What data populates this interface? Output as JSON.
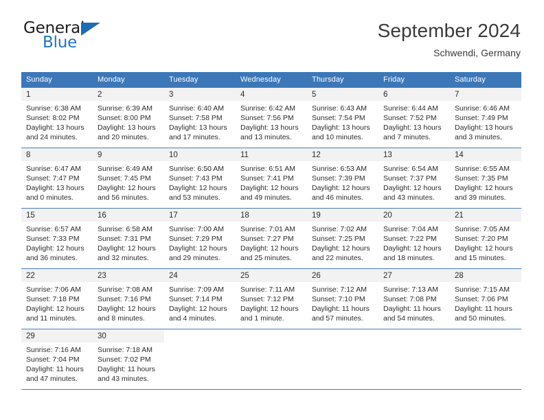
{
  "brand": {
    "name_top": "General",
    "name_bottom": "Blue",
    "triangle_color": "#1b6cb5",
    "blue_text_color": "#1f74c4"
  },
  "header": {
    "month_title": "September 2024",
    "location": "Schwendi, Germany",
    "header_bg_color": "#3c77b8"
  },
  "weekday_headers": [
    "Sunday",
    "Monday",
    "Tuesday",
    "Wednesday",
    "Thursday",
    "Friday",
    "Saturday"
  ],
  "weeks": [
    [
      {
        "day": "1",
        "sunrise": "Sunrise: 6:38 AM",
        "sunset": "Sunset: 8:02 PM",
        "daylight": "Daylight: 13 hours and 24 minutes."
      },
      {
        "day": "2",
        "sunrise": "Sunrise: 6:39 AM",
        "sunset": "Sunset: 8:00 PM",
        "daylight": "Daylight: 13 hours and 20 minutes."
      },
      {
        "day": "3",
        "sunrise": "Sunrise: 6:40 AM",
        "sunset": "Sunset: 7:58 PM",
        "daylight": "Daylight: 13 hours and 17 minutes."
      },
      {
        "day": "4",
        "sunrise": "Sunrise: 6:42 AM",
        "sunset": "Sunset: 7:56 PM",
        "daylight": "Daylight: 13 hours and 13 minutes."
      },
      {
        "day": "5",
        "sunrise": "Sunrise: 6:43 AM",
        "sunset": "Sunset: 7:54 PM",
        "daylight": "Daylight: 13 hours and 10 minutes."
      },
      {
        "day": "6",
        "sunrise": "Sunrise: 6:44 AM",
        "sunset": "Sunset: 7:52 PM",
        "daylight": "Daylight: 13 hours and 7 minutes."
      },
      {
        "day": "7",
        "sunrise": "Sunrise: 6:46 AM",
        "sunset": "Sunset: 7:49 PM",
        "daylight": "Daylight: 13 hours and 3 minutes."
      }
    ],
    [
      {
        "day": "8",
        "sunrise": "Sunrise: 6:47 AM",
        "sunset": "Sunset: 7:47 PM",
        "daylight": "Daylight: 13 hours and 0 minutes."
      },
      {
        "day": "9",
        "sunrise": "Sunrise: 6:49 AM",
        "sunset": "Sunset: 7:45 PM",
        "daylight": "Daylight: 12 hours and 56 minutes."
      },
      {
        "day": "10",
        "sunrise": "Sunrise: 6:50 AM",
        "sunset": "Sunset: 7:43 PM",
        "daylight": "Daylight: 12 hours and 53 minutes."
      },
      {
        "day": "11",
        "sunrise": "Sunrise: 6:51 AM",
        "sunset": "Sunset: 7:41 PM",
        "daylight": "Daylight: 12 hours and 49 minutes."
      },
      {
        "day": "12",
        "sunrise": "Sunrise: 6:53 AM",
        "sunset": "Sunset: 7:39 PM",
        "daylight": "Daylight: 12 hours and 46 minutes."
      },
      {
        "day": "13",
        "sunrise": "Sunrise: 6:54 AM",
        "sunset": "Sunset: 7:37 PM",
        "daylight": "Daylight: 12 hours and 43 minutes."
      },
      {
        "day": "14",
        "sunrise": "Sunrise: 6:55 AM",
        "sunset": "Sunset: 7:35 PM",
        "daylight": "Daylight: 12 hours and 39 minutes."
      }
    ],
    [
      {
        "day": "15",
        "sunrise": "Sunrise: 6:57 AM",
        "sunset": "Sunset: 7:33 PM",
        "daylight": "Daylight: 12 hours and 36 minutes."
      },
      {
        "day": "16",
        "sunrise": "Sunrise: 6:58 AM",
        "sunset": "Sunset: 7:31 PM",
        "daylight": "Daylight: 12 hours and 32 minutes."
      },
      {
        "day": "17",
        "sunrise": "Sunrise: 7:00 AM",
        "sunset": "Sunset: 7:29 PM",
        "daylight": "Daylight: 12 hours and 29 minutes."
      },
      {
        "day": "18",
        "sunrise": "Sunrise: 7:01 AM",
        "sunset": "Sunset: 7:27 PM",
        "daylight": "Daylight: 12 hours and 25 minutes."
      },
      {
        "day": "19",
        "sunrise": "Sunrise: 7:02 AM",
        "sunset": "Sunset: 7:25 PM",
        "daylight": "Daylight: 12 hours and 22 minutes."
      },
      {
        "day": "20",
        "sunrise": "Sunrise: 7:04 AM",
        "sunset": "Sunset: 7:22 PM",
        "daylight": "Daylight: 12 hours and 18 minutes."
      },
      {
        "day": "21",
        "sunrise": "Sunrise: 7:05 AM",
        "sunset": "Sunset: 7:20 PM",
        "daylight": "Daylight: 12 hours and 15 minutes."
      }
    ],
    [
      {
        "day": "22",
        "sunrise": "Sunrise: 7:06 AM",
        "sunset": "Sunset: 7:18 PM",
        "daylight": "Daylight: 12 hours and 11 minutes."
      },
      {
        "day": "23",
        "sunrise": "Sunrise: 7:08 AM",
        "sunset": "Sunset: 7:16 PM",
        "daylight": "Daylight: 12 hours and 8 minutes."
      },
      {
        "day": "24",
        "sunrise": "Sunrise: 7:09 AM",
        "sunset": "Sunset: 7:14 PM",
        "daylight": "Daylight: 12 hours and 4 minutes."
      },
      {
        "day": "25",
        "sunrise": "Sunrise: 7:11 AM",
        "sunset": "Sunset: 7:12 PM",
        "daylight": "Daylight: 12 hours and 1 minute."
      },
      {
        "day": "26",
        "sunrise": "Sunrise: 7:12 AM",
        "sunset": "Sunset: 7:10 PM",
        "daylight": "Daylight: 11 hours and 57 minutes."
      },
      {
        "day": "27",
        "sunrise": "Sunrise: 7:13 AM",
        "sunset": "Sunset: 7:08 PM",
        "daylight": "Daylight: 11 hours and 54 minutes."
      },
      {
        "day": "28",
        "sunrise": "Sunrise: 7:15 AM",
        "sunset": "Sunset: 7:06 PM",
        "daylight": "Daylight: 11 hours and 50 minutes."
      }
    ],
    [
      {
        "day": "29",
        "sunrise": "Sunrise: 7:16 AM",
        "sunset": "Sunset: 7:04 PM",
        "daylight": "Daylight: 11 hours and 47 minutes."
      },
      {
        "day": "30",
        "sunrise": "Sunrise: 7:18 AM",
        "sunset": "Sunset: 7:02 PM",
        "daylight": "Daylight: 11 hours and 43 minutes."
      },
      {
        "day": "",
        "sunrise": "",
        "sunset": "",
        "daylight": ""
      },
      {
        "day": "",
        "sunrise": "",
        "sunset": "",
        "daylight": ""
      },
      {
        "day": "",
        "sunrise": "",
        "sunset": "",
        "daylight": ""
      },
      {
        "day": "",
        "sunrise": "",
        "sunset": "",
        "daylight": ""
      },
      {
        "day": "",
        "sunrise": "",
        "sunset": "",
        "daylight": ""
      }
    ]
  ]
}
